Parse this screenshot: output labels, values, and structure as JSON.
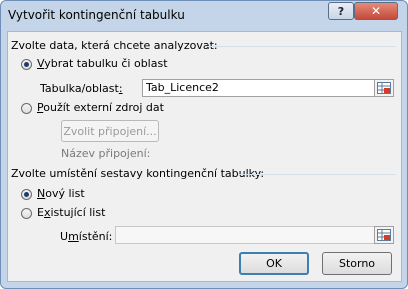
{
  "window": {
    "title": "Vytvořit kontingenční tabulku",
    "help_glyph": "?",
    "close_glyph": "✕"
  },
  "source": {
    "heading": "Zvolte data, která chcete analyzovat:",
    "option_range": {
      "key": "V",
      "rest": "ybrat tabulku či oblast",
      "selected": true
    },
    "range_label_pre": "Tabulka/oblast",
    "range_label_key": ":",
    "range_value": "Tab_Licence2",
    "option_external": {
      "key": "P",
      "rest": "oužít externí zdroj dat",
      "selected": false
    },
    "choose_connection": "Zvolit připojení...",
    "connection_name_label": "Název připojení:"
  },
  "destination": {
    "heading": "Zvolte umístění sestavy kontingenční tabulky:",
    "option_new": {
      "key": "N",
      "rest": "ový list",
      "selected": true
    },
    "option_existing": {
      "pre": "E",
      "key": "x",
      "rest": "istující list",
      "selected": false
    },
    "location_pre": "U",
    "location_key": "m",
    "location_rest": "ístění:",
    "location_value": ""
  },
  "buttons": {
    "ok": "OK",
    "cancel": "Storno"
  },
  "icons": {
    "help": "help-icon",
    "close": "close-icon",
    "range_picker": "range-picker-icon"
  },
  "colors": {
    "title_bar": "#c5d5e9",
    "close_button": "#c44a3b",
    "dialog_background": "#f0f0f0"
  }
}
